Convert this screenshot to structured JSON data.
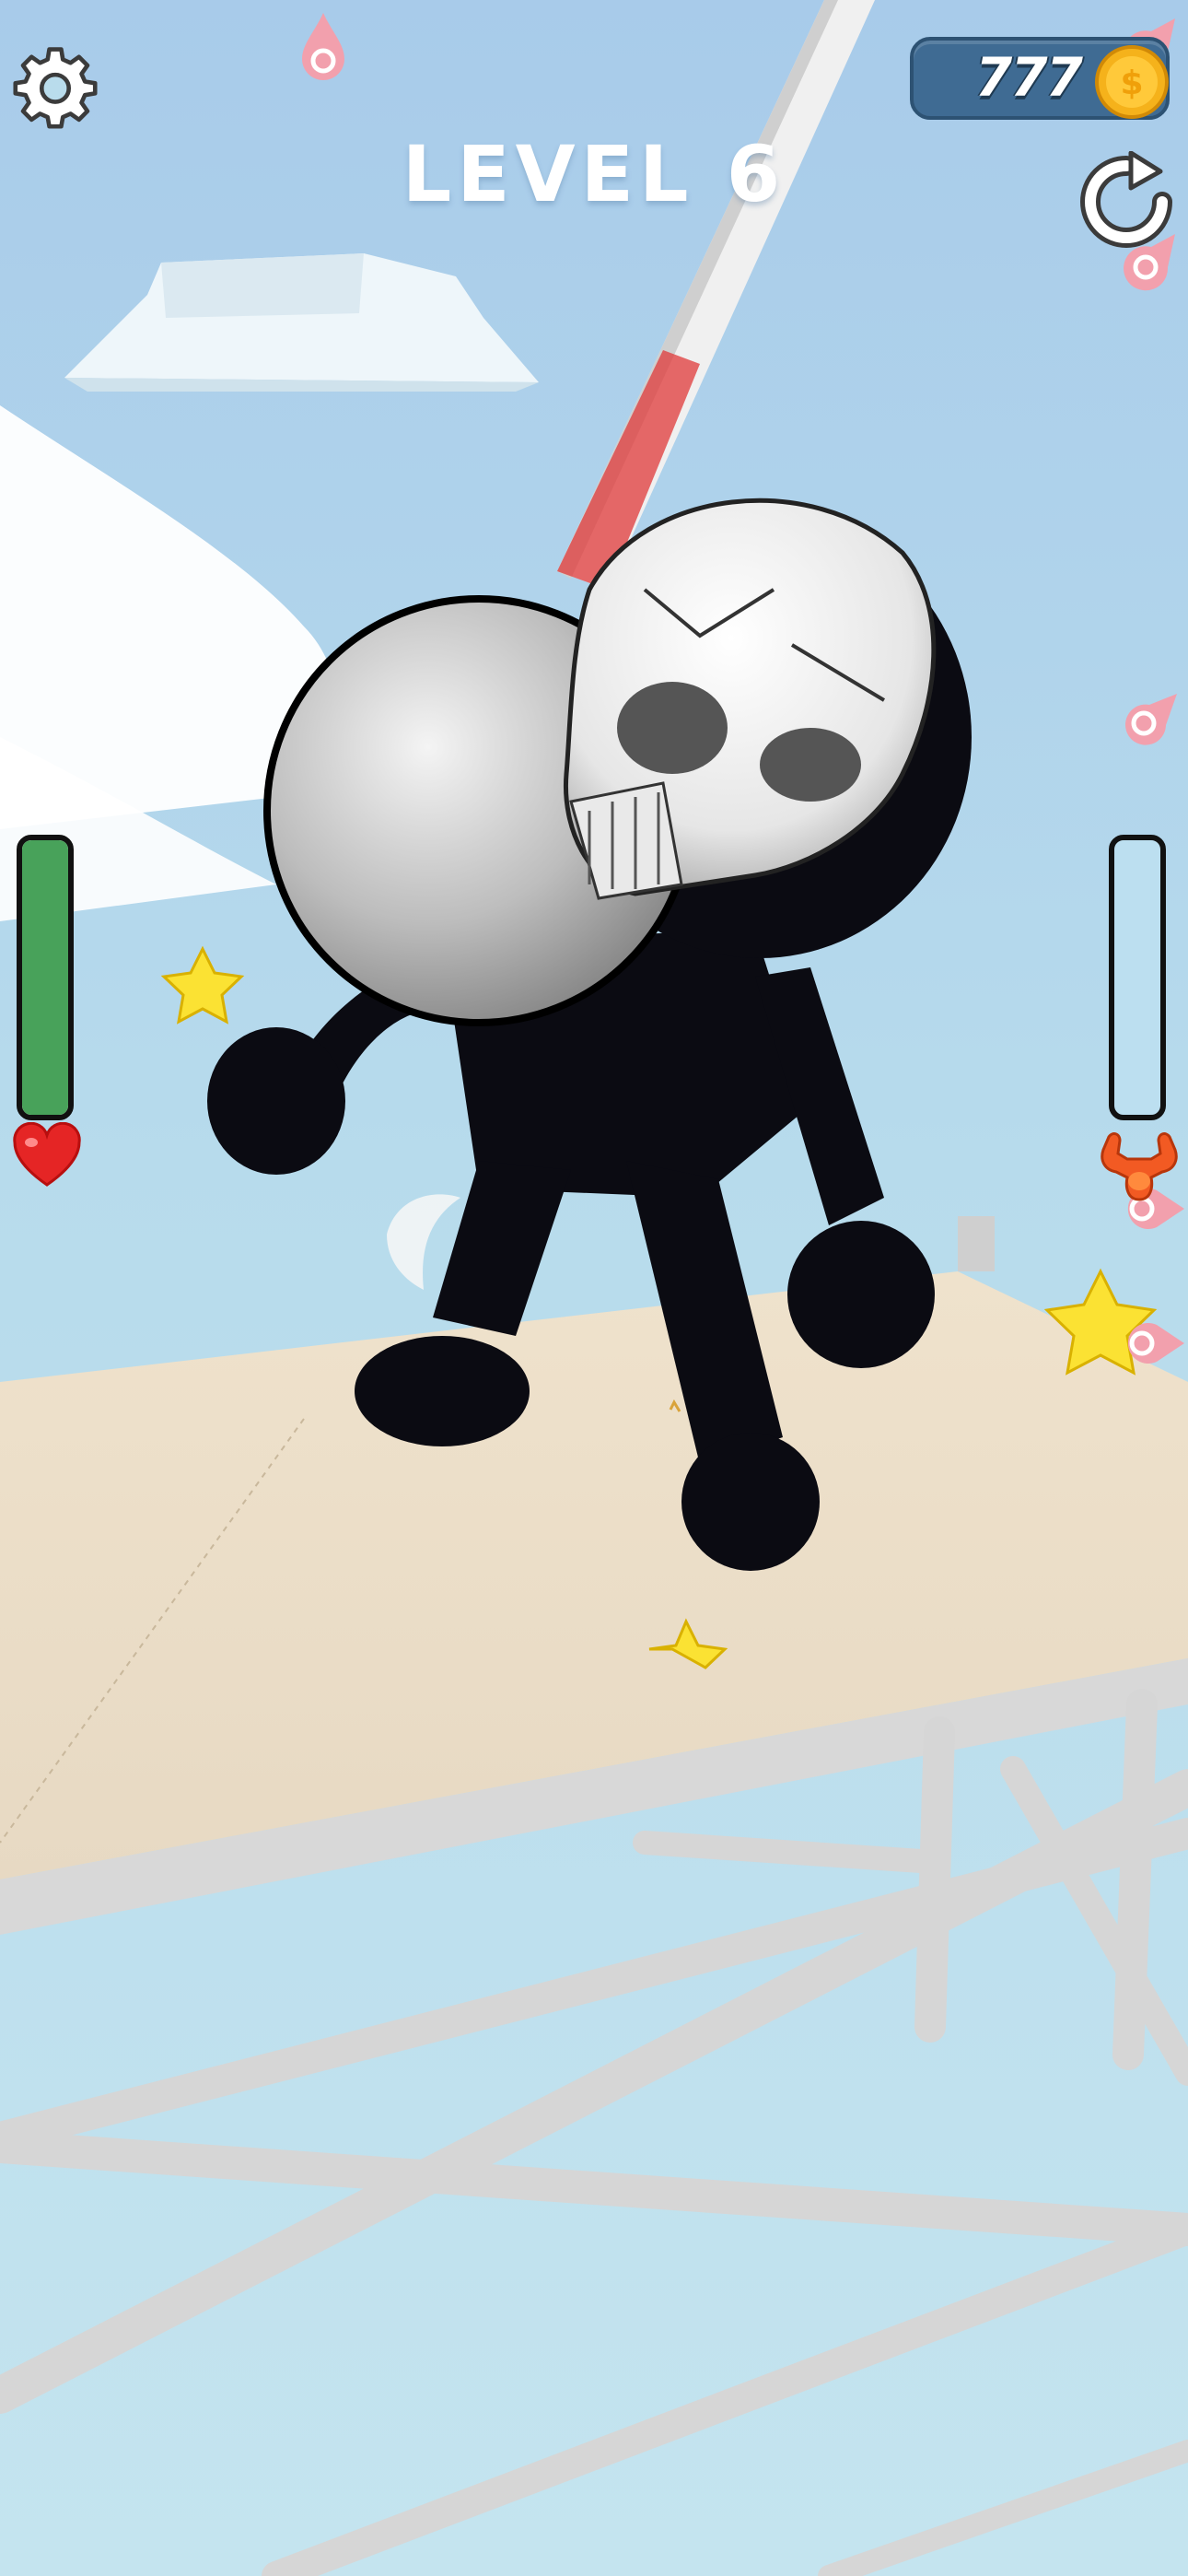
{
  "hud": {
    "coins": "777",
    "level_title": "LEVEL 6"
  },
  "player_health": {
    "fill_percent": 100,
    "color": "#48a25a",
    "icon": "heart-icon"
  },
  "enemy_health": {
    "fill_percent": 0,
    "color": "#e8453a",
    "icon": "muscle-strength-icon"
  },
  "icons": {
    "settings": "gear-icon",
    "restart": "refresh-icon",
    "coin": "coin-icon",
    "target_markers": "target-marker-icon",
    "stars": "star-icon"
  },
  "colors": {
    "sky": "#b9dcec",
    "panel": "#3f6b93",
    "coin": "#f5b21b",
    "star": "#fbe233",
    "stage": "#eee0c9"
  }
}
